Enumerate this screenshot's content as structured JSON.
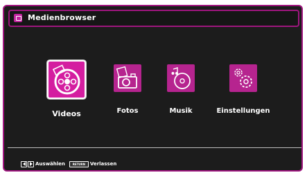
{
  "window": {
    "title": "Medienbrowser",
    "title_icon": "media-icon"
  },
  "menu": {
    "items": [
      {
        "label": "Videos",
        "icon": "film-reel-icon",
        "selected": true
      },
      {
        "label": "Fotos",
        "icon": "camera-photo-icon",
        "selected": false
      },
      {
        "label": "Musik",
        "icon": "music-cd-icon",
        "selected": false
      },
      {
        "label": "Einstellungen",
        "icon": "settings-gears-icon",
        "selected": false
      }
    ]
  },
  "footer": {
    "navigate_label": "Auswählen",
    "return_key": "RETURN",
    "exit_label": "Verlassen"
  },
  "colors": {
    "accent": "#b6248f",
    "background": "#1c1c1c",
    "border": "#a0167f"
  }
}
